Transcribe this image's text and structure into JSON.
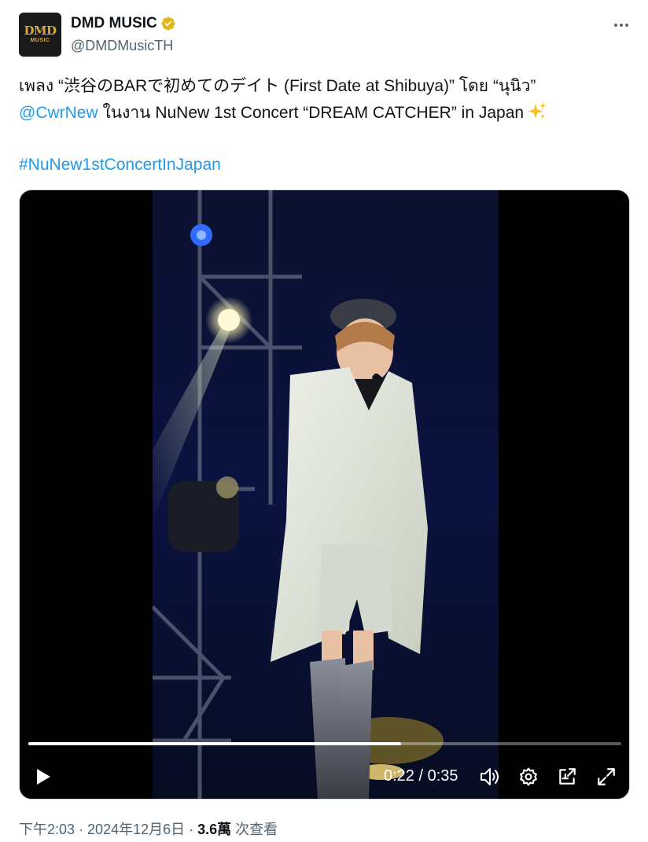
{
  "author": {
    "display_name": "DMD MUSIC",
    "handle": "@DMDMusicTH",
    "avatar_text": "DMD",
    "avatar_subtext": "MUSIC",
    "verified_color": "#e2b719"
  },
  "tweet": {
    "line1": "เพลง “渋谷のBARで初めてのデイト (First Date at Shibuya)” โดย “นุนิว”",
    "mention": "@CwrNew",
    "line2_rest": " ในงาน NuNew 1st Concert “DREAM CATCHER” in Japan",
    "hashtag": "#NuNew1stConcertInJapan"
  },
  "video": {
    "current_time": "0:22",
    "duration": "0:35",
    "time_display": "0:22 / 0:35",
    "progress": 0.6286,
    "icons": [
      "play-icon",
      "volume-icon",
      "settings-icon",
      "picture-in-picture-icon",
      "fullscreen-icon"
    ]
  },
  "footer": {
    "time": "下午2:03",
    "sep1": " · ",
    "date": "2024年12月6日",
    "sep2": " · ",
    "views": "3.6萬",
    "views_label": " 次查看"
  },
  "colors": {
    "link": "#1d9bf0",
    "secondary_text": "#536471",
    "primary_text": "#0f1419"
  }
}
